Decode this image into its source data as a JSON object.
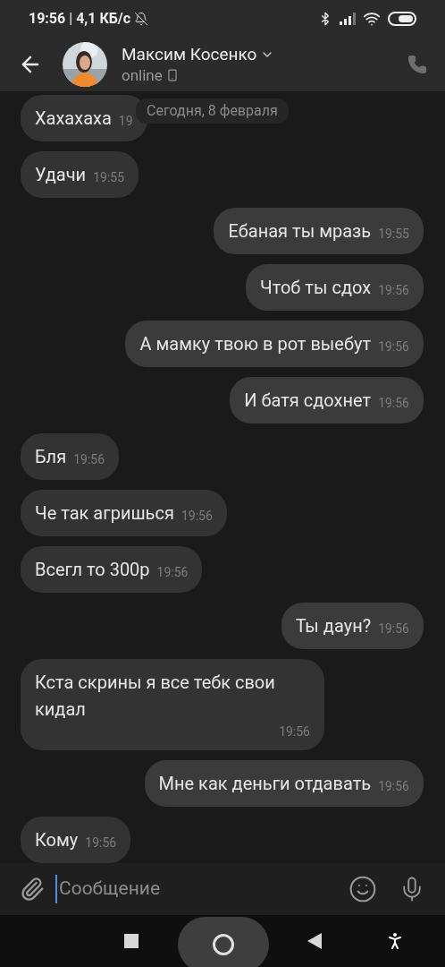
{
  "status_bar": {
    "time": "19:56",
    "separator": "|",
    "speed": "4,1 КБ/с"
  },
  "header": {
    "name": "Максим Косенко",
    "status": "online"
  },
  "date_label": "Сегодня, 8 февраля",
  "messages": [
    {
      "kind": "incoming",
      "text": "Хахахаха",
      "time": "19"
    },
    {
      "kind": "incoming",
      "text": "Удачи",
      "time": "19:55"
    },
    {
      "kind": "outgoing",
      "text": "Ебаная ты мразь",
      "time": "19:55"
    },
    {
      "kind": "outgoing",
      "text": "Чтоб ты сдох",
      "time": "19:56"
    },
    {
      "kind": "outgoing",
      "text": "А мамку твою в рот выебут",
      "time": "19:56"
    },
    {
      "kind": "outgoing",
      "text": "И батя сдохнет",
      "time": "19:56"
    },
    {
      "kind": "incoming",
      "text": "Бля",
      "time": "19:56"
    },
    {
      "kind": "incoming",
      "text": "Че так агришься",
      "time": "19:56"
    },
    {
      "kind": "incoming",
      "text": "Всегл то 300р",
      "time": "19:56"
    },
    {
      "kind": "outgoing",
      "text": "Ты даун?",
      "time": "19:56"
    },
    {
      "kind": "incoming",
      "text": "Кста скрины я все тебк свои кидал",
      "time": "19:56"
    },
    {
      "kind": "outgoing",
      "text": "Мне как деньги отдавать",
      "time": "19:56"
    },
    {
      "kind": "incoming",
      "text": "Кому",
      "time": "19:56"
    }
  ],
  "composer": {
    "placeholder": "Сообщение"
  }
}
